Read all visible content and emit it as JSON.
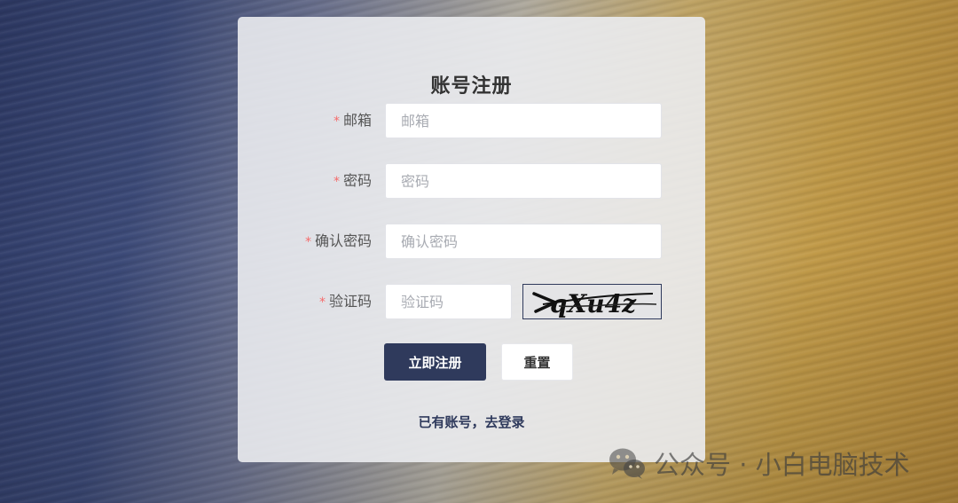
{
  "form": {
    "title": "账号注册",
    "required_mark": "*",
    "email": {
      "label": "邮箱",
      "placeholder": "邮箱",
      "value": ""
    },
    "password": {
      "label": "密码",
      "placeholder": "密码",
      "value": ""
    },
    "confirm_password": {
      "label": "确认密码",
      "placeholder": "确认密码",
      "value": ""
    },
    "captcha": {
      "label": "验证码",
      "placeholder": "验证码",
      "value": "",
      "image_text": "qXu4z"
    },
    "register_button": "立即注册",
    "reset_button": "重置",
    "login_link": "已有账号，去登录"
  },
  "watermark": {
    "text": "公众号 · 小白电脑技术",
    "icon": "wechat-icon"
  },
  "colors": {
    "primary": "#2f3a5c",
    "required": "#f56c6c",
    "card_bg": "#ebecf0"
  }
}
